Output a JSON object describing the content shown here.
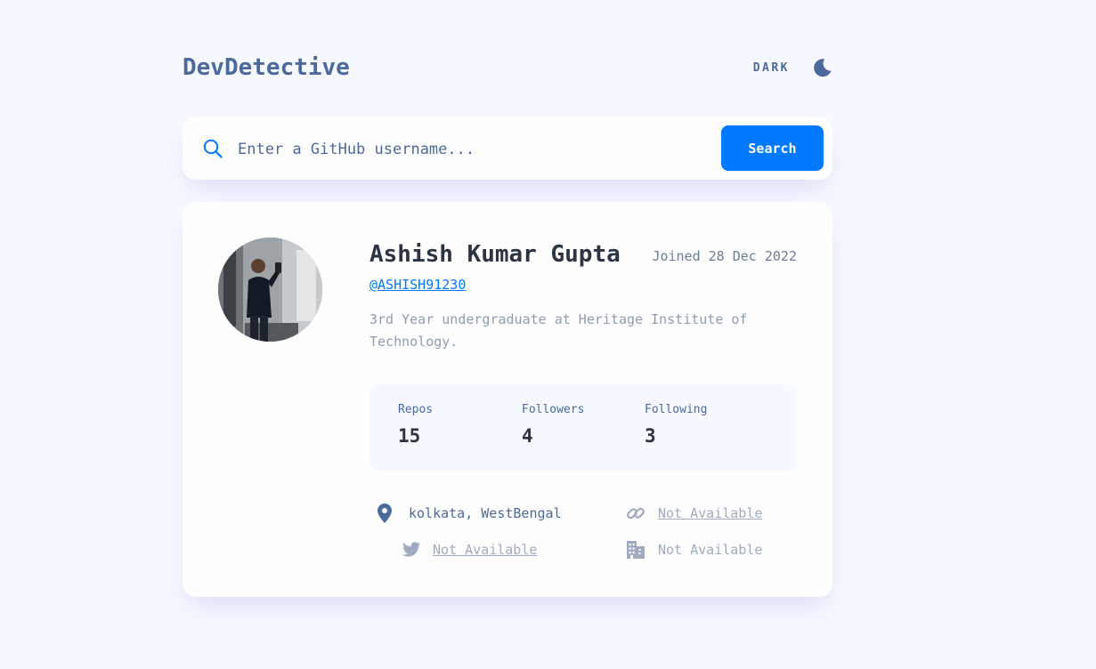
{
  "header": {
    "logo": "DevDetective",
    "mode_label": "DARK",
    "mode_icon": "moon-icon"
  },
  "search": {
    "placeholder": "Enter a GitHub username...",
    "button_label": "Search",
    "icon": "search-icon"
  },
  "profile": {
    "name": "Ashish Kumar Gupta",
    "joined": "Joined 28 Dec 2022",
    "username": "@ASHISH91230",
    "bio": "3rd Year undergraduate at Heritage Institute of Technology.",
    "stats": [
      {
        "label": "Repos",
        "value": "15"
      },
      {
        "label": "Followers",
        "value": "4"
      },
      {
        "label": "Following",
        "value": "3"
      }
    ],
    "links": {
      "location": "kolkata, WestBengal",
      "website": "Not Available",
      "twitter": "Not Available",
      "company": "Not Available"
    }
  },
  "colors": {
    "accent": "#0079ff",
    "background": "#f6f8ff",
    "card": "#fefefe",
    "text_primary": "#2b3442",
    "text_secondary": "#4b6a9b",
    "muted": "#a0abc1"
  }
}
